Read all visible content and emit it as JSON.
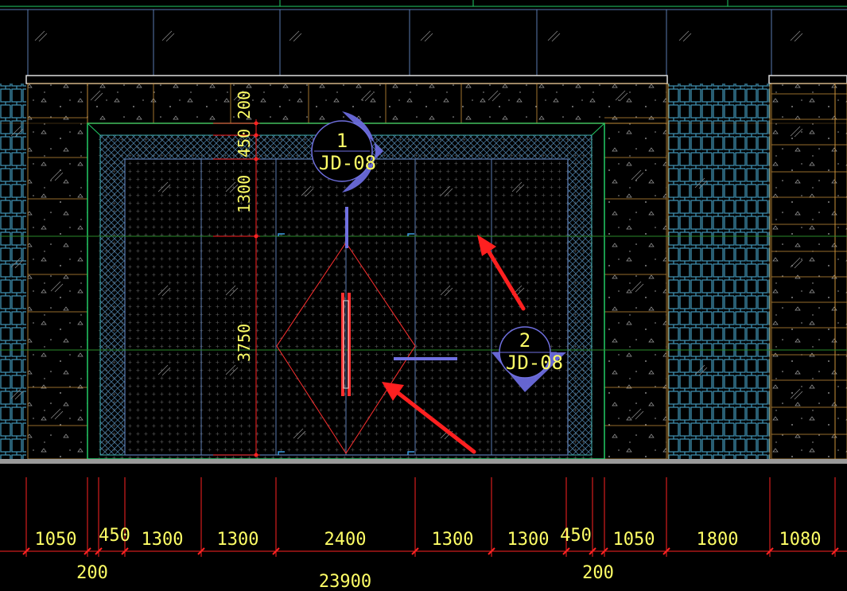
{
  "colors": {
    "background": "#000000",
    "dimension_red": "#ff2222",
    "dimension_text": "#ffff66",
    "frame_green": "#22cc66",
    "panel_blue": "#5a7ab0",
    "lattice_teal": "#3f8fb0",
    "tile_orange": "#c8903a",
    "marker_purple": "#7070e0",
    "door_red": "#ff3030",
    "arrow_red": "#ff2020",
    "ground": "#9a9a9a"
  },
  "bottom_dimensions": {
    "segments": [
      "1050",
      "450",
      "1300",
      "1300",
      "2400",
      "1300",
      "1300",
      "450",
      "1050",
      "1800",
      "1080"
    ],
    "small_left": "200",
    "small_right": "200",
    "total": "23900"
  },
  "vertical_dimensions": [
    "200",
    "450",
    "1300",
    "3750"
  ],
  "section_markers": [
    {
      "number": "1",
      "code": "JD-08",
      "direction": "right"
    },
    {
      "number": "2",
      "code": "JD-08",
      "direction": "down"
    }
  ],
  "icons": {
    "arrow_1": "red-arrow-icon",
    "arrow_2": "red-arrow-icon",
    "hatch": "glass-hatch-icon"
  }
}
